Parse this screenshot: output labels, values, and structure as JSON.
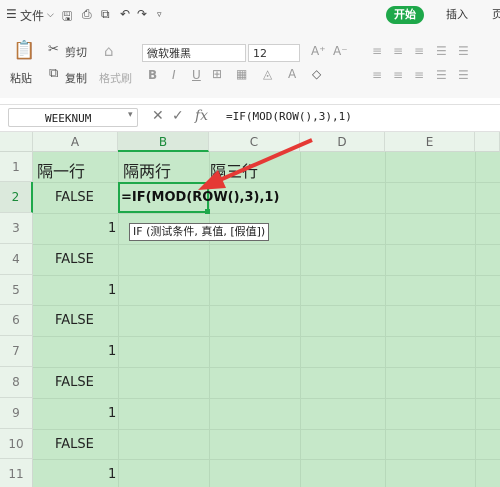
{
  "menubar": {
    "menu_icon": "hamburger-icon",
    "file_label": "文件",
    "tab_home": "开始",
    "tab_insert": "插入",
    "tab_more": "页"
  },
  "toolbar": {
    "cut_label": "剪切",
    "copy_label": "复制",
    "paste_label": "粘贴",
    "format_painter_label": "格式刷",
    "font_name": "微软雅黑",
    "font_size": "12",
    "bold": "B",
    "italic": "I",
    "underline": "U"
  },
  "formula_bar": {
    "name_box": "WEEKNUM",
    "formula": "=IF(MOD(ROW(),3),1)"
  },
  "sheet": {
    "columns": [
      "A",
      "B",
      "C",
      "D",
      "E"
    ],
    "selected_column": "B",
    "rows": [
      "1",
      "2",
      "3",
      "4",
      "5",
      "6",
      "7",
      "8",
      "9",
      "10",
      "11"
    ],
    "selected_row": "2",
    "cells": {
      "A1": "隔一行",
      "B1": "隔两行",
      "C1": "隔三行",
      "A2": "FALSE",
      "A3": "1",
      "A4": "FALSE",
      "A5": "1",
      "A6": "FALSE",
      "A7": "1",
      "A8": "FALSE",
      "A9": "1",
      "A10": "FALSE",
      "A11": "1"
    },
    "editing_cell": {
      "ref": "B2",
      "formula": "=IF(MOD(ROW(),3),1)"
    },
    "function_hint": "IF (测试条件, 真值, [假值])"
  },
  "colors": {
    "accent": "#1ea84a",
    "grid_background": "#c6e8c9",
    "arrow": "#e53935"
  }
}
